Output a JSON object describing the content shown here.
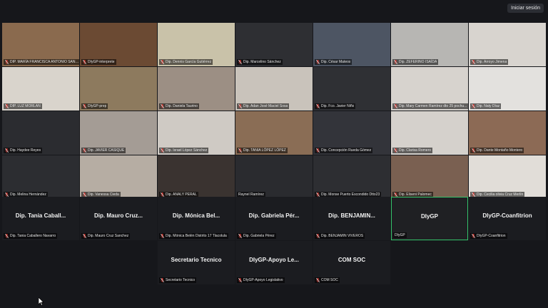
{
  "header": {
    "signin_label": "Iniciar sesión"
  },
  "colors": {
    "background": "#16171b",
    "tile_bg": "#1b1c20",
    "muted_icon": "#e0372f",
    "active_border": "#35c46b"
  },
  "icons": {
    "muted": "microphone-muted-icon",
    "cursor": "mouse-cursor-icon"
  },
  "video_tiles": [
    {
      "label": "DIP. MARÍA FRANCISCA ANTONIO SANT..."
    },
    {
      "label": "DIyGP-interprete"
    },
    {
      "label": "Dip. Dennis García Gutiérrez"
    },
    {
      "label": "Dip. Marcelino Sánchez"
    },
    {
      "label": "Dip. César Mateos"
    },
    {
      "label": "Dip. ZEFERINO ISAÍDA"
    },
    {
      "label": "Dip. Arroyo Jimena"
    },
    {
      "label": "DIP. LUZ MORLAN"
    },
    {
      "label": "DIyGP-prep"
    },
    {
      "label": "Dip. Daniela Taurino"
    },
    {
      "label": "Dip. Adan José Maciel Sosa"
    },
    {
      "label": "Dip. Fco. Javier Niño"
    },
    {
      "label": "Dip. Mary Carmen Ramírez dto 25 pochu..."
    },
    {
      "label": "Dip. Naty Díaz"
    },
    {
      "label": "Dip. Haydee Reyes"
    },
    {
      "label": "Dip. JAVIER CASIQUE"
    },
    {
      "label": "Dip. Israel López Sánchez"
    },
    {
      "label": "Dip. TANIA LÓPEZ LÓPEZ"
    },
    {
      "label": "Dip. Concepción Rueda Gómez"
    },
    {
      "label": "Dip. Clarisa Romero"
    },
    {
      "label": "Dip. Dante Montaño Montero"
    },
    {
      "label": "Dip. Melina Hernández"
    },
    {
      "label": "Dip. Vanessa Cieda"
    },
    {
      "label": "Dip. ANALY PERAL"
    },
    {
      "label": "Raynel Ramírez"
    },
    {
      "label": "Dip. Monse Puerto Escondido Dtto23"
    },
    {
      "label": "Dip. Eliseni Palomec"
    },
    {
      "label": "Dip. Cecilia olivia Cruz Merlín"
    }
  ],
  "placeholder_tiles": [
    {
      "display_name": "Dip. Tania Caball...",
      "label": "Dip. Tania Caballero Navarro"
    },
    {
      "display_name": "Dip. Mauro Cruz...",
      "label": "Dip. Mauro Cruz Sanchez"
    },
    {
      "display_name": "Dip. Mónica Bel...",
      "label": "Dip. Mónica Belén Distrito 17 Tlacolula"
    },
    {
      "display_name": "Dip. Gabriela Pér...",
      "label": "Dip. Gabriela Pérez"
    },
    {
      "display_name": "Dip. BENJAMIN...",
      "label": "Dip. BENJAMIN VIVEROS"
    },
    {
      "display_name": "DIyGP",
      "label": "DIyGP"
    },
    {
      "display_name": "DIyGP-Coanfitrion",
      "label": "DIyGP-Coanfitrion"
    },
    {
      "display_name": "Secretario Tecnico",
      "label": "Secretario Tecnico"
    },
    {
      "display_name": "DIyGP-Apoyo Le...",
      "label": "DIyGP-Apoyo Legislativo"
    },
    {
      "display_name": "COM SOC",
      "label": "COM SOC"
    }
  ]
}
